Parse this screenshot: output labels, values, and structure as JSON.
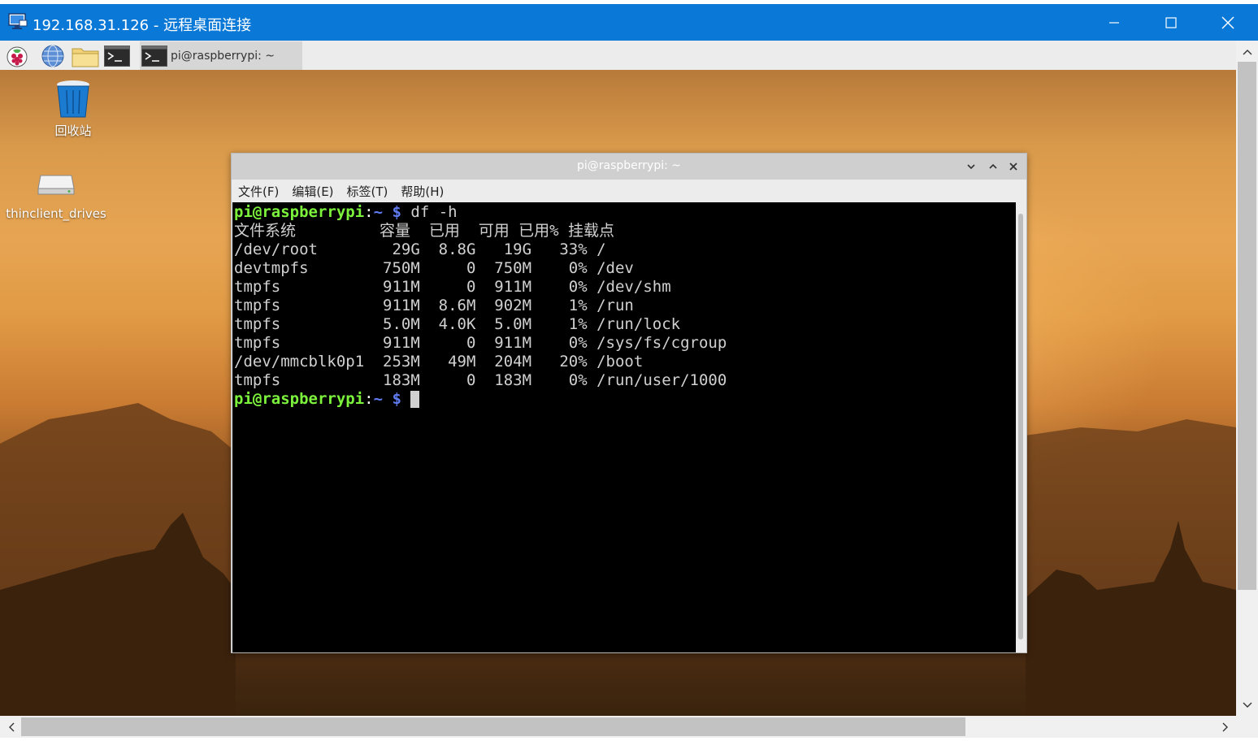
{
  "rdp": {
    "title": "192.168.31.126 - 远程桌面连接",
    "icon": "remote-desktop-icon"
  },
  "taskbar": {
    "buttons": [
      "raspberry-menu-icon",
      "web-browser-icon",
      "file-manager-icon",
      "terminal-icon"
    ],
    "task_label": "pi@raspberrypi: ~"
  },
  "desktop": {
    "trash_label": "回收站",
    "drive_label": "thinclient_drives"
  },
  "terminal": {
    "title": "pi@raspberrypi: ~",
    "menu": [
      "文件(F)",
      "编辑(E)",
      "标签(T)",
      "帮助(H)"
    ],
    "prompt": {
      "user_host": "pi@raspberrypi",
      "colon": ":",
      "path": "~",
      "dollar": "$"
    },
    "command": " df -h",
    "output_lines": [
      "文件系统         容量  已用  可用 已用% 挂载点",
      "/dev/root        29G  8.8G   19G   33% /",
      "devtmpfs        750M     0  750M    0% /dev",
      "tmpfs           911M     0  911M    0% /dev/shm",
      "tmpfs           911M  8.6M  902M    1% /run",
      "tmpfs           5.0M  4.0K  5.0M    1% /run/lock",
      "tmpfs           911M     0  911M    0% /sys/fs/cgroup",
      "/dev/mmcblk0p1  253M   49M  204M   20% /boot",
      "tmpfs           183M     0  183M    0% /run/user/1000"
    ]
  },
  "colors": {
    "rdp_titlebar": "#0a78d7",
    "prompt_user": "#7cf23c",
    "prompt_path": "#5f7cf2",
    "terminal_bg": "#000000"
  }
}
